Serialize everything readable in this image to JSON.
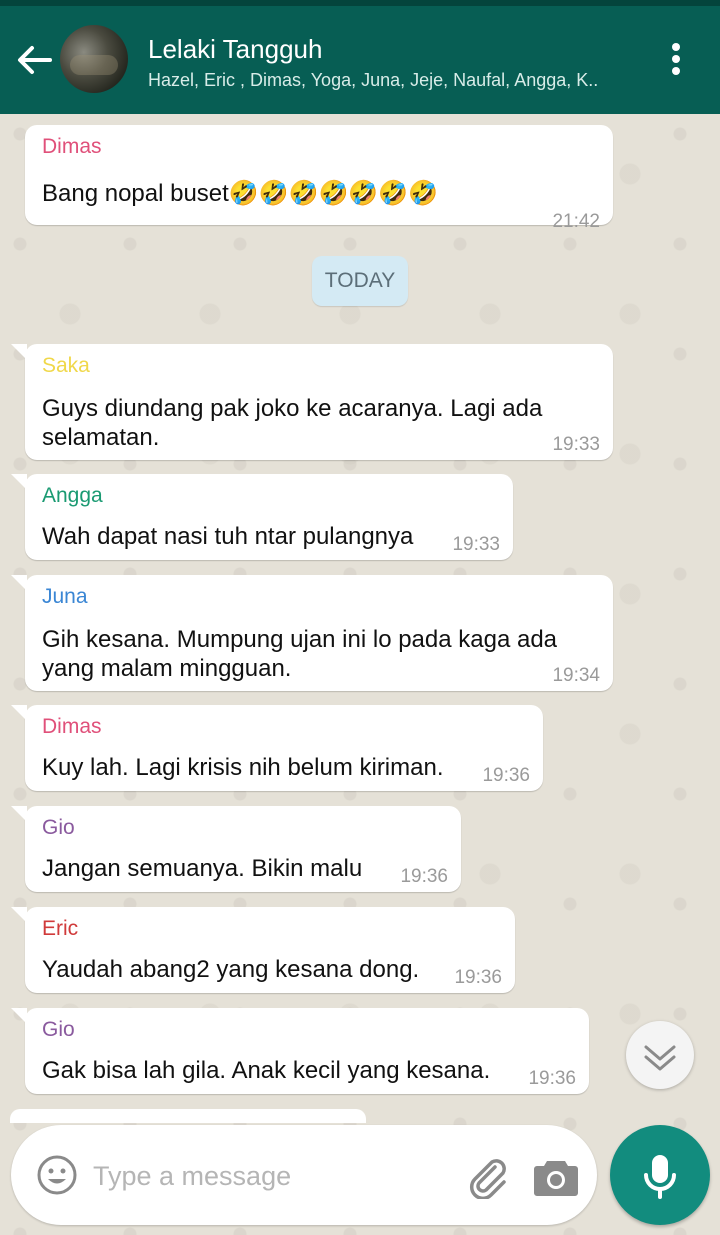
{
  "header": {
    "title": "Lelaki Tangguh",
    "subtitle": "Hazel, Eric , Dimas, Yoga, Juna, Jeje, Naufal, Angga, K.."
  },
  "colors": {
    "header": "#075e54",
    "accent": "#128c7e",
    "sender_dimas": "#e0507a",
    "sender_saka": "#f0d84a",
    "sender_angga": "#1a9a72",
    "sender_juna": "#3a86d4",
    "sender_gio": "#8a5a9e",
    "sender_eric": "#d03a3a"
  },
  "messages": [
    {
      "sender": "Dimas",
      "text": "Bang nopal buset🤣🤣🤣🤣🤣🤣🤣",
      "time": "21:42"
    },
    {
      "sender": "Saka",
      "text": "Guys diundang pak joko ke acaranya. Lagi ada selamatan.",
      "time": "19:33"
    },
    {
      "sender": "Angga",
      "text": "Wah dapat nasi tuh ntar pulangnya",
      "time": "19:33"
    },
    {
      "sender": "Juna",
      "text": "Gih kesana. Mumpung ujan ini lo pada kaga ada yang malam mingguan.",
      "time": "19:34"
    },
    {
      "sender": "Dimas",
      "text": "Kuy lah. Lagi krisis nih belum kiriman.",
      "time": "19:36"
    },
    {
      "sender": "Gio",
      "text": "Jangan semuanya. Bikin malu",
      "time": "19:36"
    },
    {
      "sender": "Eric",
      "text": "Yaudah abang2 yang kesana dong.",
      "time": "19:36"
    },
    {
      "sender": "Gio",
      "text": "Gak bisa lah gila. Anak kecil yang kesana.",
      "time": "19:36"
    }
  ],
  "date_divider": "TODAY",
  "composer": {
    "placeholder": "Type a message",
    "icons": [
      "emoji-icon",
      "attachment-icon",
      "camera-icon",
      "mic-icon"
    ]
  },
  "icons": {
    "back": "arrow-left-icon",
    "menu": "more-vert-icon",
    "scroll": "chevron-down-icon"
  }
}
